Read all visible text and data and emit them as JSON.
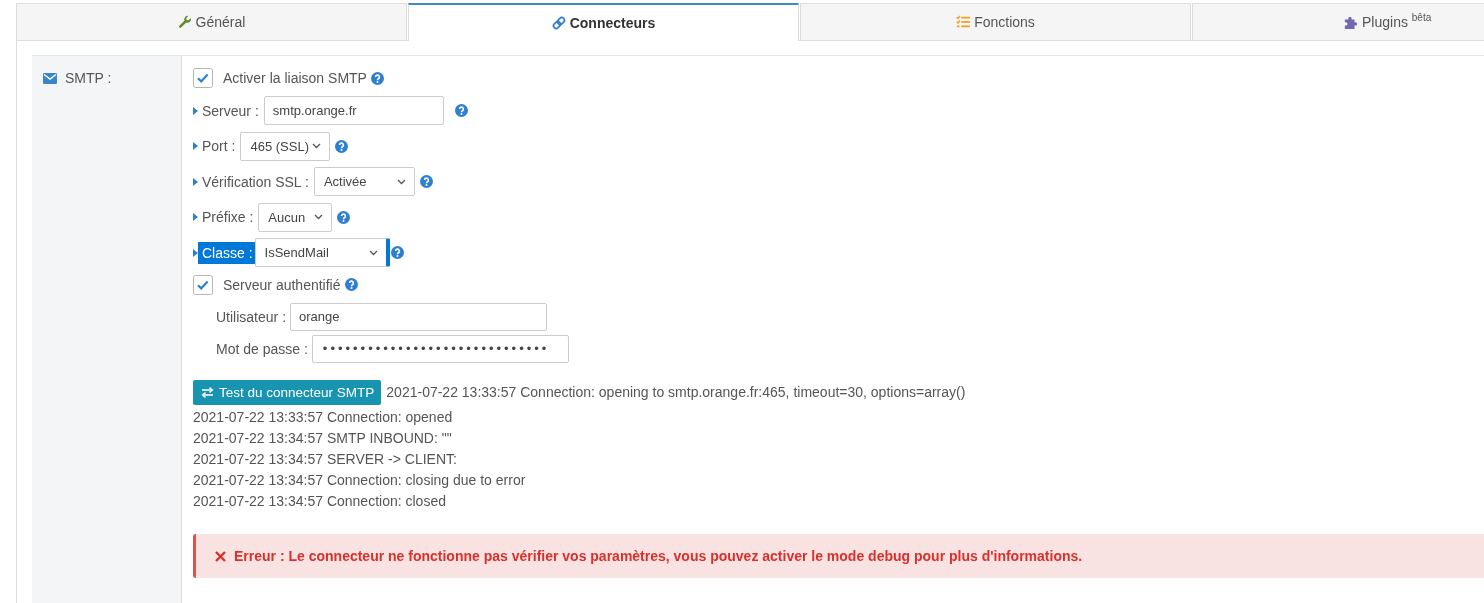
{
  "tabs": [
    {
      "label": "Général",
      "selected": false
    },
    {
      "label": "Connecteurs",
      "selected": true
    },
    {
      "label": "Fonctions",
      "selected": false
    },
    {
      "label": "Plugins $^{bêta}$",
      "selected": false
    }
  ],
  "smtp": {
    "label": "SMTP :",
    "enable": {
      "label": "Activer la liaison SMTP",
      "checked": true
    },
    "fields": [
      {
        "kind": "input",
        "label": "Serveur :",
        "value": "smtp.orange.fr",
        "highlighted": false
      },
      {
        "kind": "select",
        "label": "Port :",
        "value": "465 (SSL)",
        "highlighted": false
      },
      {
        "kind": "select",
        "label": "Vérification SSL :",
        "value": "Activée",
        "highlighted": false
      },
      {
        "kind": "select",
        "label": "Préfixe :",
        "value": "Aucun",
        "highlighted": false
      },
      {
        "kind": "select",
        "label": "Classe :",
        "value": "IsSendMail",
        "highlighted": true
      }
    ],
    "auth": {
      "label": "Serveur authentifié",
      "checked": true
    },
    "credentials": [
      {
        "label": "Utilisateur :",
        "value": "orange"
      },
      {
        "label": "Mot de passe :",
        "value": "••••••••••••••••••••••••••••••"
      }
    ],
    "test_button": {
      "label": "Test du connecteur SMTP"
    },
    "log": [
      "2021-07-22 13:33:57 Connection: opening to smtp.orange.fr:465, timeout=30, options=array()",
      "2021-07-22 13:33:57 Connection: opened",
      "2021-07-22 13:34:57 SMTP INBOUND: \"\"",
      "2021-07-22 13:34:57 SERVER -> CLIENT:",
      "2021-07-22 13:34:57 Connection: closing due to error",
      "2021-07-22 13:34:57 Connection: closed"
    ],
    "error": {
      "message": "Erreur : Le connecteur ne fonctionne pas vérifier vos paramètres, vous pouvez activer le mode debug pour plus d'informations."
    }
  }
}
